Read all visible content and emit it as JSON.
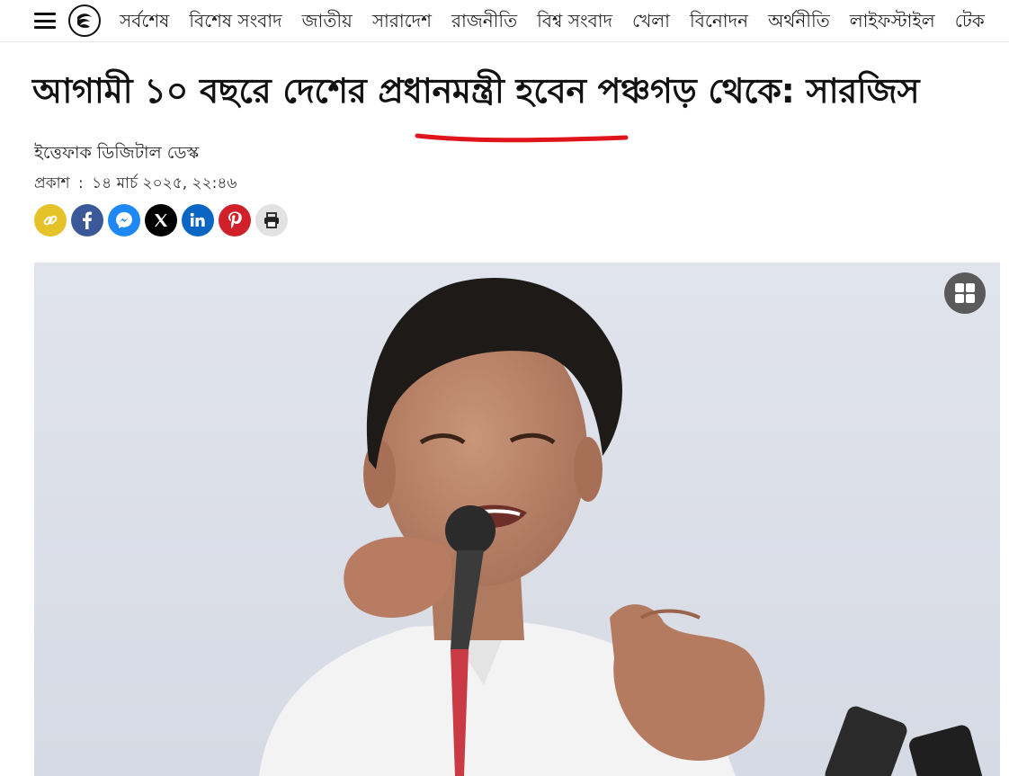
{
  "nav": {
    "items": [
      "সর্বশেষ",
      "বিশেষ সংবাদ",
      "জাতীয়",
      "সারাদেশ",
      "রাজনীতি",
      "বিশ্ব সংবাদ",
      "খেলা",
      "বিনোদন",
      "অর্থনীতি",
      "লাইফস্টাইল",
      "টেক"
    ]
  },
  "article": {
    "headline": "আগামী ১০ বছরে দেশের প্রধানমন্ত্রী হবেন পঞ্চগড় থেকে: সারজিস",
    "author": "ইত্তেফাক ডিজিটাল ডেস্ক",
    "published_label": "প্রকাশ",
    "published_sep": ":",
    "published_date": "১৪ মার্চ ২০২৫, ২২:৪৬"
  },
  "share": {
    "buttons": [
      {
        "name": "copy-link-icon",
        "color": "#e6c229"
      },
      {
        "name": "facebook-icon",
        "color": "#3b5998"
      },
      {
        "name": "messenger-icon",
        "color": "#1e88f5"
      },
      {
        "name": "x-icon",
        "color": "#000000"
      },
      {
        "name": "linkedin-icon",
        "color": "#0a66c2"
      },
      {
        "name": "pinterest-icon",
        "color": "#d0212a"
      },
      {
        "name": "print-icon",
        "color": "#e2e2e2"
      }
    ]
  },
  "colors": {
    "annotation_underline": "#e0141b"
  }
}
